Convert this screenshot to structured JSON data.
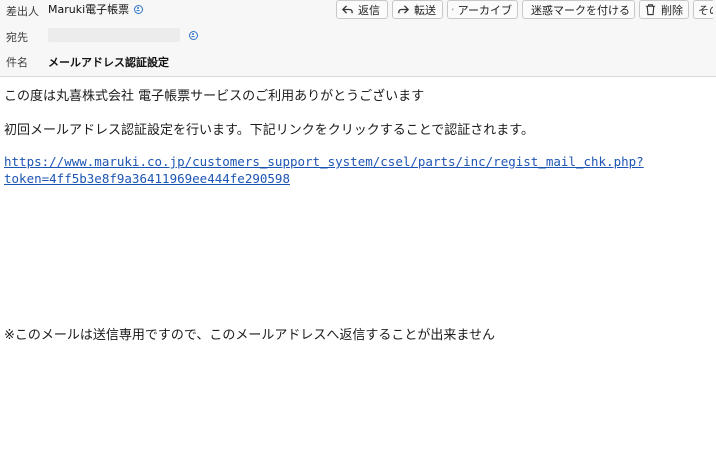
{
  "header": {
    "from_label": "差出人",
    "from_name": "Maruki電子帳票",
    "to_label": "宛先",
    "subject_label": "件名",
    "subject": "メールアドレス認証設定"
  },
  "toolbar": {
    "reply": "返信",
    "forward": "転送",
    "archive": "アーカイブ",
    "junk": "迷惑マークを付ける",
    "delete": "削除",
    "more": "その"
  },
  "message": {
    "line1": "この度は丸喜株式会社 電子帳票サービスのご利用ありがとうございます",
    "line2": "初回メールアドレス認証設定を行います。下記リンクをクリックすることで認証されます。",
    "link_line1": "https://www.maruki.co.jp/customers_support_system/csel/parts/inc/regist_mail_chk.php?",
    "link_line2": "token=4ff5b3e8f9a36411969ee444fe290598",
    "notice": "※このメールは送信専用ですので、このメールアドレスへ返信することが出来ません"
  },
  "colors": {
    "link": "#1d55b4",
    "contact_icon": "#2f74c8"
  }
}
